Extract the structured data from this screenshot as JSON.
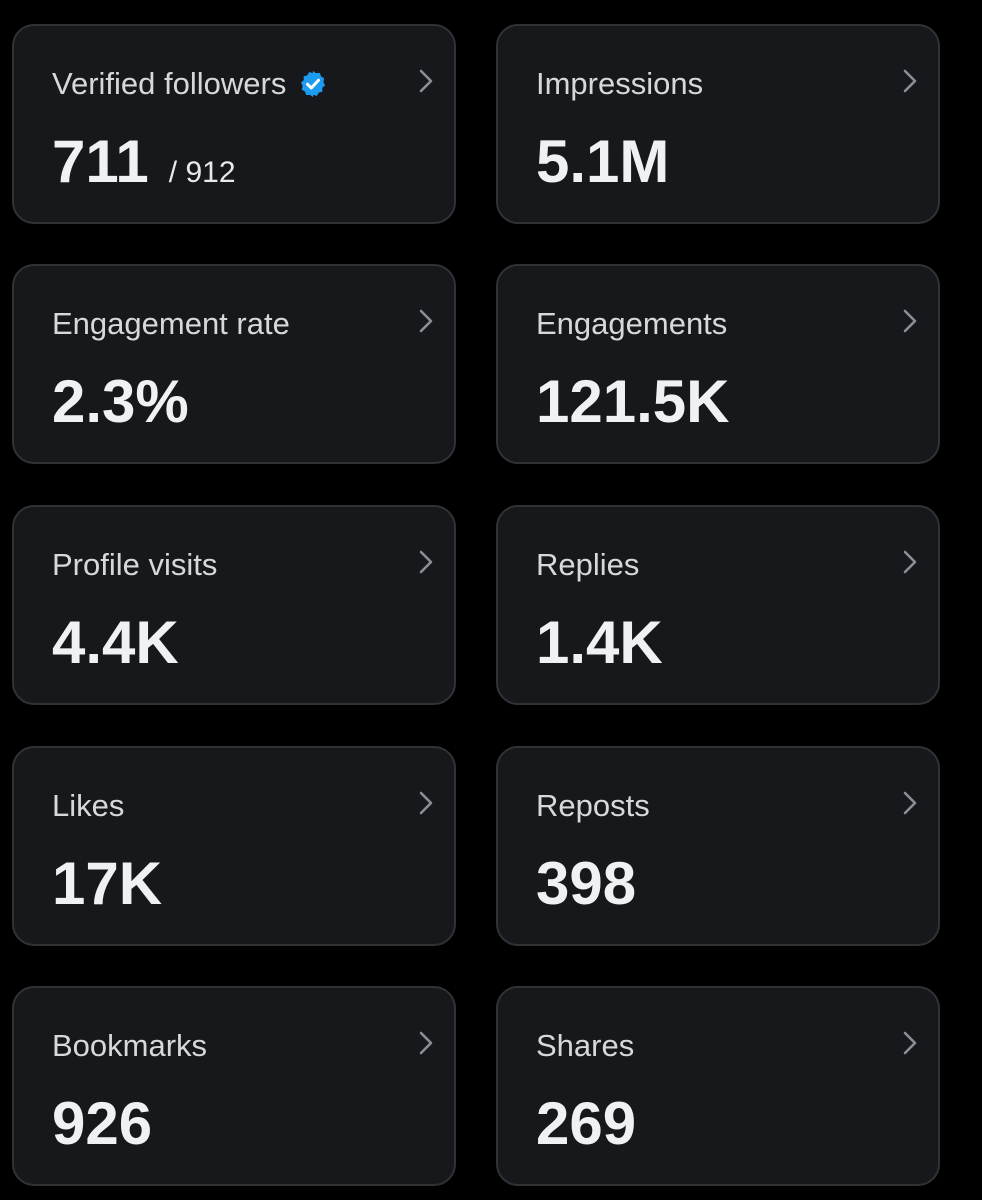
{
  "metrics": [
    {
      "label": "Verified followers",
      "value": "711",
      "subvalue": "/ 912",
      "verified_icon": "verified-badge-icon",
      "badge_color": "#1d9bf0"
    },
    {
      "label": "Impressions",
      "value": "5.1M"
    },
    {
      "label": "Engagement rate",
      "value": "2.3%"
    },
    {
      "label": "Engagements",
      "value": "121.5K"
    },
    {
      "label": "Profile visits",
      "value": "4.4K"
    },
    {
      "label": "Replies",
      "value": "1.4K"
    },
    {
      "label": "Likes",
      "value": "17K"
    },
    {
      "label": "Reposts",
      "value": "398"
    },
    {
      "label": "Bookmarks",
      "value": "926"
    },
    {
      "label": "Shares",
      "value": "269"
    }
  ],
  "icons": {
    "chevron": "chevron-right-icon"
  },
  "colors": {
    "background": "#000000",
    "card": "#17181c",
    "card_border": "#2f3336",
    "label": "#d6d9db",
    "value": "#eff2f4",
    "verified": "#1d9bf0"
  }
}
